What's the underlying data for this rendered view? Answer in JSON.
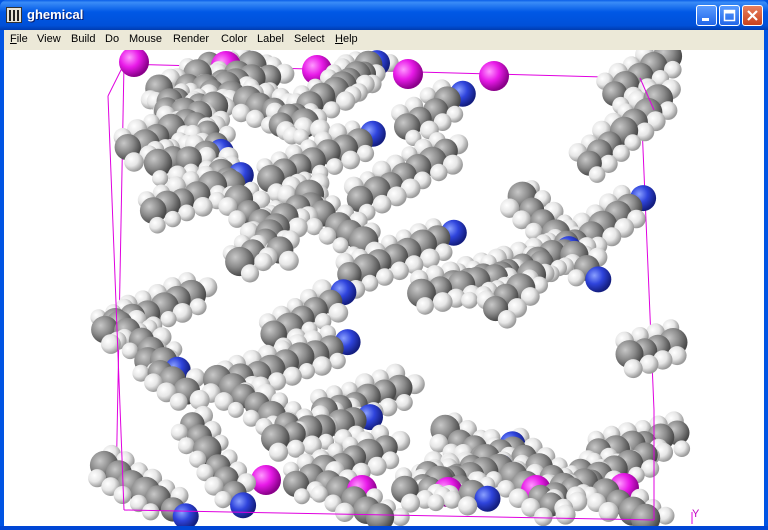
{
  "window": {
    "title": "ghemical"
  },
  "menubar": {
    "items": [
      {
        "id": "file",
        "first": "F",
        "rest": "ile"
      },
      {
        "id": "view",
        "first": "",
        "rest": "View"
      },
      {
        "id": "build",
        "first": "",
        "rest": "Build"
      },
      {
        "id": "do",
        "first": "",
        "rest": "Do"
      },
      {
        "id": "mouse",
        "first": "",
        "rest": "Mouse"
      },
      {
        "id": "render",
        "first": "",
        "rest": "Render"
      },
      {
        "id": "color",
        "first": "",
        "rest": "Color"
      },
      {
        "id": "label",
        "first": "",
        "rest": "Label"
      },
      {
        "id": "select",
        "first": "",
        "rest": "Select"
      },
      {
        "id": "help",
        "first": "H",
        "rest": "elp"
      }
    ]
  },
  "viewport": {
    "axis_label": "Y",
    "colors": {
      "background": "#ffffff",
      "box": "#e000e0",
      "carbon": "#8c8c8c",
      "hydrogen": "#e4e4e4",
      "nitrogen": "#2a3fd8",
      "magenta_atom": "#e81ae8"
    }
  },
  "titlebar": {
    "minimize_icon": "minimize-icon",
    "maximize_icon": "maximize-icon",
    "close_icon": "close-icon"
  }
}
